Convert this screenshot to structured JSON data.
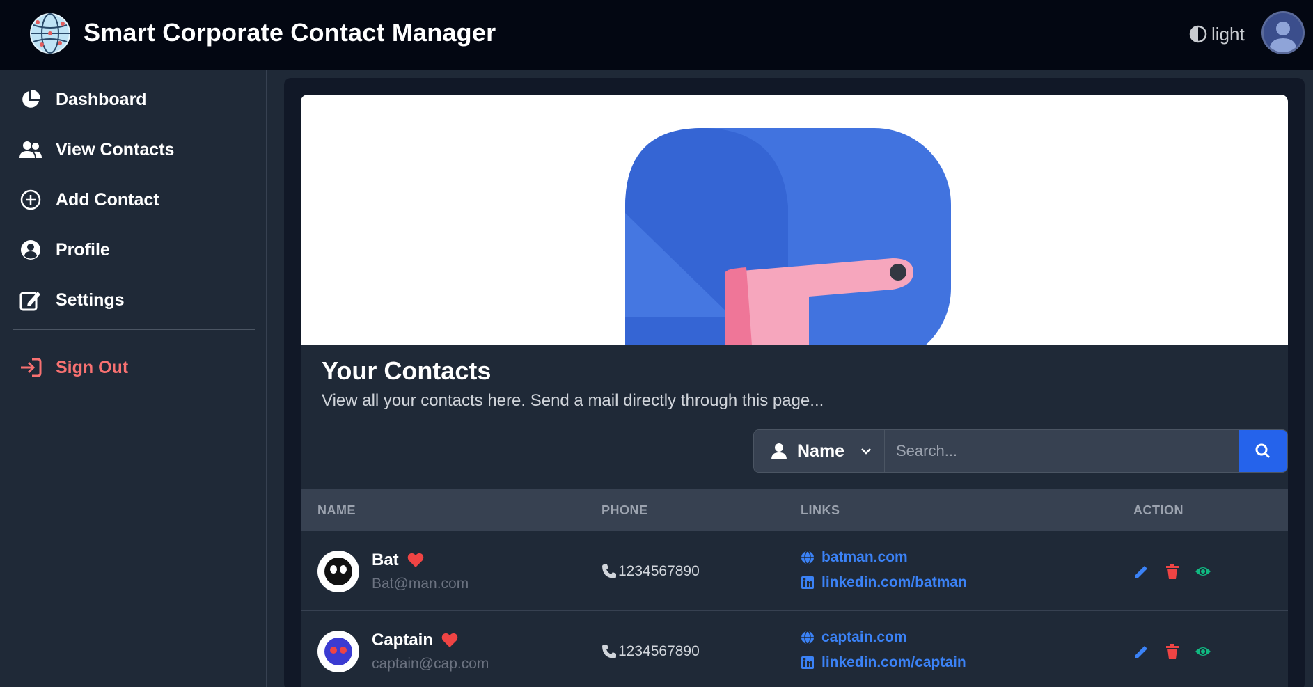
{
  "app": {
    "title": "Smart Corporate Contact Manager",
    "theme_toggle_label": "light"
  },
  "sidebar": {
    "items": [
      {
        "label": "Dashboard",
        "icon": "pie-chart-icon"
      },
      {
        "label": "View Contacts",
        "icon": "users-icon"
      },
      {
        "label": "Add Contact",
        "icon": "plus-circle-icon"
      },
      {
        "label": "Profile",
        "icon": "user-circle-icon"
      },
      {
        "label": "Settings",
        "icon": "edit-icon"
      }
    ],
    "signout_label": "Sign Out"
  },
  "page": {
    "heading": "Your Contacts",
    "subheading": "View all your contacts here. Send a mail directly through this page..."
  },
  "search": {
    "field_label": "Name",
    "placeholder": "Search..."
  },
  "table": {
    "headers": [
      "NAME",
      "PHONE",
      "LINKS",
      "ACTION"
    ],
    "rows": [
      {
        "name": "Bat",
        "email": "Bat@man.com",
        "favorite": true,
        "phone": "1234567890",
        "website": "batman.com",
        "linkedin": "linkedin.com/batman"
      },
      {
        "name": "Captain",
        "email": "captain@cap.com",
        "favorite": true,
        "phone": "1234567890",
        "website": "captain.com",
        "linkedin": "linkedin.com/captain"
      }
    ]
  },
  "colors": {
    "navbar_bg": "#030712",
    "sidebar_bg": "#1f2937",
    "accent_blue": "#2563eb",
    "link_blue": "#3b82f6",
    "danger_red": "#ef4444",
    "view_green": "#10b981",
    "signout_red": "#f87171"
  }
}
